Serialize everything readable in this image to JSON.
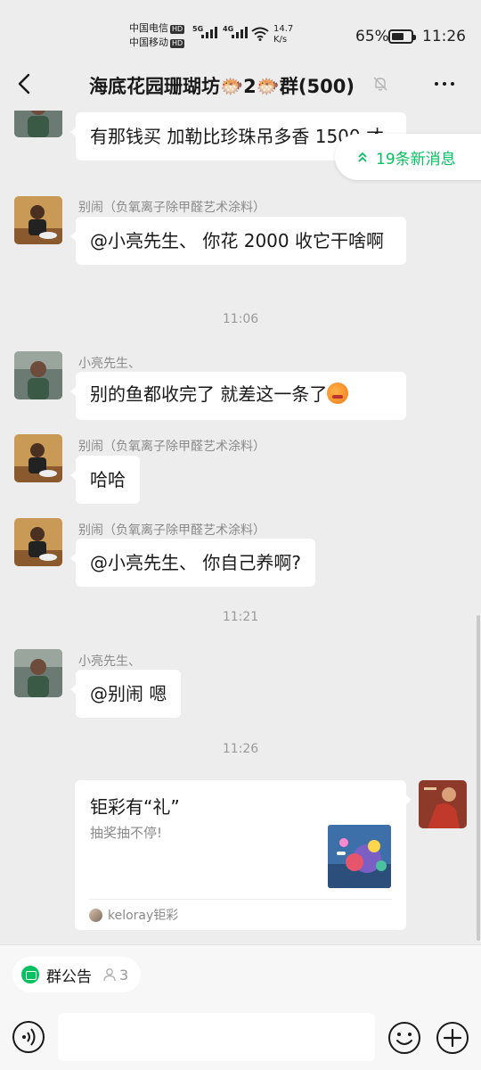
{
  "status_bar": {
    "carrier1": "中国电信",
    "carrier2": "中国移动",
    "hd_badge": "HD",
    "net1": "5G",
    "net2": "4G",
    "speed_value": "14.7",
    "speed_unit": "K/s",
    "battery_pct": "65%",
    "battery_level": 0.65,
    "time": "11:26"
  },
  "header": {
    "title": "海底花园珊瑚坊🐡2🐡群(500)",
    "back_icon": "chevron-left-icon",
    "mute_icon": "bell-off-icon",
    "more_icon": "ellipsis-icon"
  },
  "new_messages": {
    "label": "19条新消息",
    "icon": "double-chevron-up-icon",
    "color": "#07c160"
  },
  "messages": [
    {
      "sender": "",
      "text": "有那钱买 加勒比珍珠吊多香 1500 才"
    },
    {
      "sender": "别闹（负氧离子除甲醛艺术涂料）",
      "text": "@小亮先生、 你花 2000 收它干啥啊"
    },
    {
      "sender": "小亮先生、",
      "text": "别的鱼都收完了 就差这一条了"
    },
    {
      "sender": "别闹（负氧离子除甲醛艺术涂料）",
      "text": "哈哈"
    },
    {
      "sender": "别闹（负氧离子除甲醛艺术涂料）",
      "text": "@小亮先生、 你自己养啊?"
    },
    {
      "sender": "小亮先生、",
      "text": "@别闹  嗯"
    }
  ],
  "timestamps": [
    "11:06",
    "11:21",
    "11:26"
  ],
  "card": {
    "title": "钜彩有“礼”",
    "desc": "抽奖抽不停!",
    "source": "keloray钜彩"
  },
  "bottom": {
    "notice_label": "群公告",
    "notice_count": "3",
    "voice_icon": "voice-icon",
    "emoji_icon": "smile-icon",
    "plus_icon": "plus-circle-icon"
  }
}
